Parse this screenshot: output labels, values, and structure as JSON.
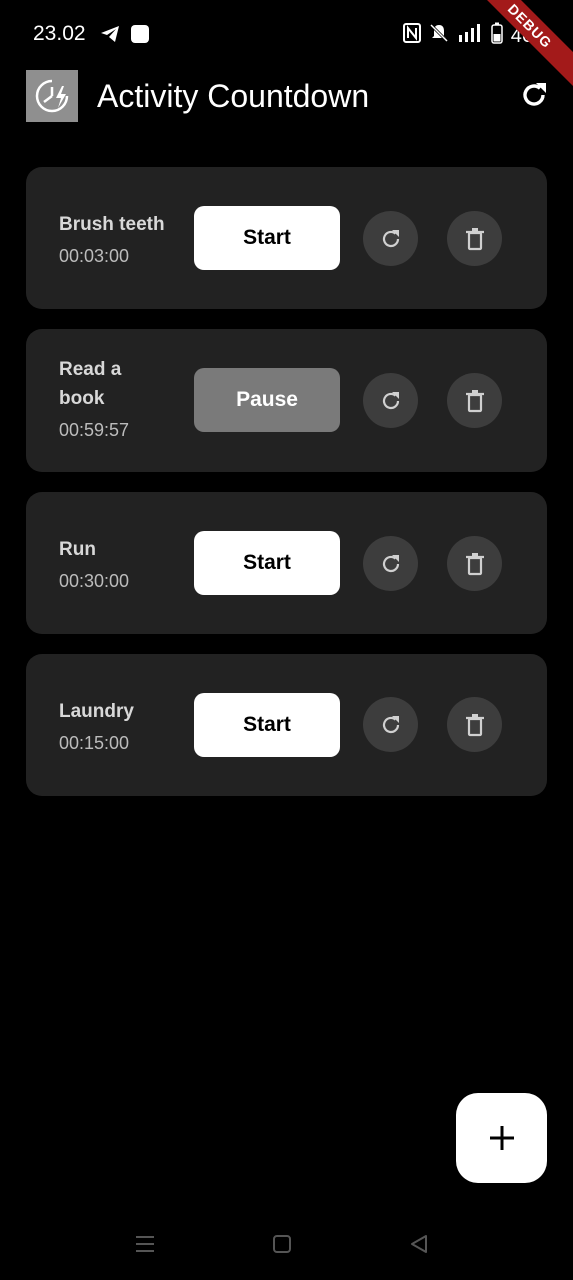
{
  "status_bar": {
    "time": "23.02",
    "battery": "46"
  },
  "debug_banner": "DEBUG",
  "app_bar": {
    "title": "Activity Countdown"
  },
  "activities": [
    {
      "name": "Brush teeth",
      "time": "00:03:00",
      "button": "Start",
      "state": "stopped"
    },
    {
      "name": "Read a book",
      "time": "00:59:57",
      "button": "Pause",
      "state": "running"
    },
    {
      "name": "Run",
      "time": "00:30:00",
      "button": "Start",
      "state": "stopped"
    },
    {
      "name": "Laundry",
      "time": "00:15:00",
      "button": "Start",
      "state": "stopped"
    }
  ],
  "colors": {
    "background": "#000000",
    "card": "#222222",
    "start_button": "#ffffff",
    "pause_button": "#7a7a7a",
    "circle_button": "#3d3d3d",
    "debug_ribbon": "#a31a1a"
  },
  "icons": [
    "telegram-icon",
    "nfc-icon",
    "mute-icon",
    "signal-icon",
    "battery-icon",
    "refresh-icon",
    "reset-icon",
    "trash-icon",
    "plus-icon"
  ]
}
